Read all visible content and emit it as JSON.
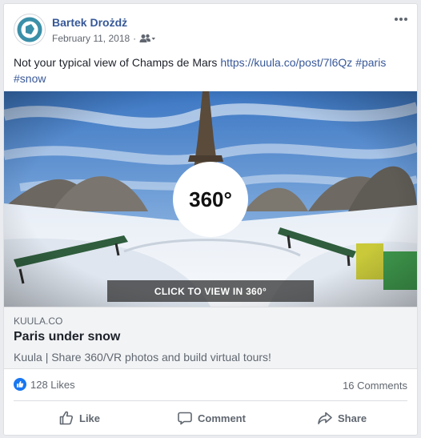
{
  "post": {
    "author": "Bartek Drożdż",
    "date": "February 11, 2018",
    "audience_icon": "friends-icon",
    "text_prefix": "Not your typical view of Champs de Mars ",
    "link": "https://kuula.co/post/7l6Qz",
    "hashtag_paris": "#paris",
    "hashtag_snow": "#snow"
  },
  "media": {
    "badge": "360°",
    "cta": "CLICK TO VIEW IN 360°"
  },
  "link_preview": {
    "domain": "KUULA.CO",
    "title": "Paris under snow",
    "description": "Kuula | Share 360/VR photos and build virtual tours!"
  },
  "stats": {
    "likes": "128 Likes",
    "comments": "16 Comments"
  },
  "actions": {
    "like": "Like",
    "comment": "Comment",
    "share": "Share"
  },
  "colors": {
    "author": "#365899",
    "link": "#385898",
    "like_blue": "#1877f2",
    "avatar_teal": "#3b8fa8"
  }
}
